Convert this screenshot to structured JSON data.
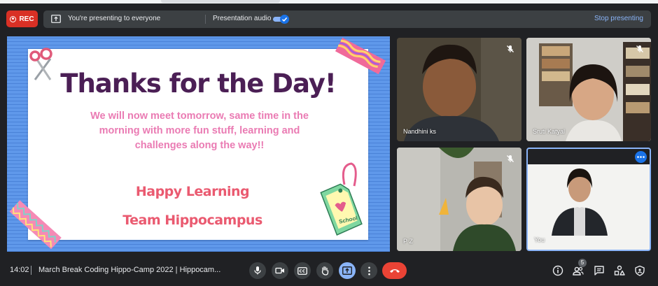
{
  "header": {
    "rec_label": "REC",
    "presenting_text": "You're presenting to everyone",
    "audio_label": "Presentation audio",
    "audio_on": true,
    "stop_label": "Stop presenting",
    "accent": "#8ab4f8"
  },
  "slide": {
    "title": "Thanks for the Day!",
    "message": "We will now meet tomorrow, same time in the morning with more fun stuff, learning and challenges along the way!!",
    "line1": "Happy Learning",
    "line2": "Team Hippocampus",
    "tag_text": "School"
  },
  "participants": [
    {
      "name": "Nandhini ks",
      "muted": true
    },
    {
      "name": "Sruti Katyal",
      "muted": true
    },
    {
      "name": "P Z",
      "muted": true
    },
    {
      "name": "You",
      "muted": false
    }
  ],
  "bottom": {
    "time": "14:02",
    "meeting_title": "March Break Coding Hippo-Camp 2022 | Hippocam...",
    "people_count": "5",
    "end_color": "#ea4335"
  },
  "icons": [
    "rec-icon",
    "present-icon",
    "toggle-check-icon",
    "mic-off-icon",
    "mic-icon",
    "camera-icon",
    "captions-icon",
    "raise-hand-icon",
    "present-now-icon",
    "more-options-icon",
    "end-call-icon",
    "info-icon",
    "people-icon",
    "chat-icon",
    "activities-icon",
    "host-controls-icon",
    "more-dots-icon"
  ]
}
